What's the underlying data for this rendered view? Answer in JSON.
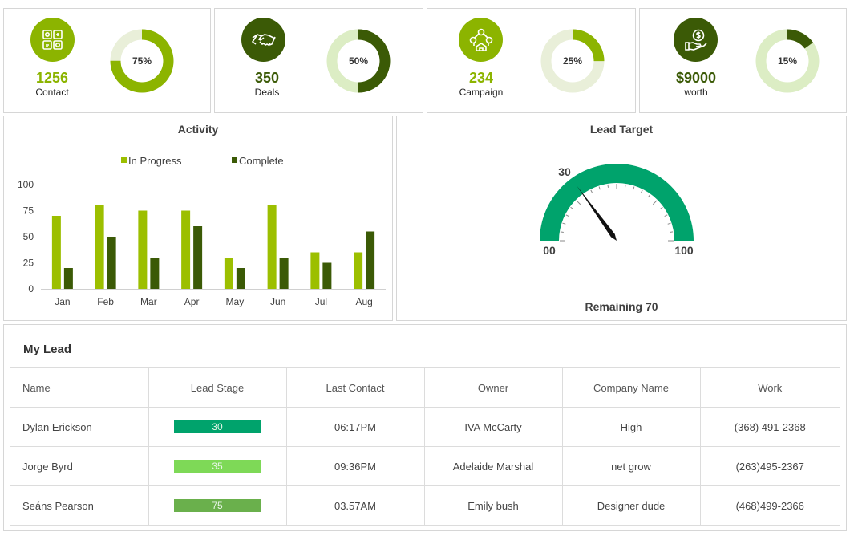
{
  "kpis": [
    {
      "value": "1256",
      "label": "Contact",
      "percent": 75,
      "percent_label": "75%",
      "color": "#8cb400",
      "track": "#e9efd9",
      "icon_bg": "#8cb400",
      "icon": "contact-apps-icon"
    },
    {
      "value": "350",
      "label": "Deals",
      "percent": 50,
      "percent_label": "50%",
      "color": "#3b5a06",
      "track": "#dcedc4",
      "icon_bg": "#3b5a06",
      "icon": "handshake-icon"
    },
    {
      "value": "234",
      "label": "Campaign",
      "percent": 25,
      "percent_label": "25%",
      "color": "#8cb400",
      "track": "#e9efd9",
      "icon_bg": "#8cb400",
      "icon": "campaign-network-icon"
    },
    {
      "value": "$9000",
      "label": "worth",
      "percent": 15,
      "percent_label": "15%",
      "color": "#3b5a06",
      "track": "#dcedc4",
      "icon_bg": "#3b5a06",
      "icon": "money-hand-icon"
    }
  ],
  "activity": {
    "title": "Activity",
    "chart_data": {
      "type": "bar",
      "categories": [
        "Jan",
        "Feb",
        "Mar",
        "Apr",
        "May",
        "Jun",
        "Jul",
        "Aug"
      ],
      "series": [
        {
          "name": "In Progress",
          "values": [
            70,
            80,
            75,
            75,
            30,
            80,
            35,
            35
          ],
          "color": "#9cbf00"
        },
        {
          "name": "Complete",
          "values": [
            20,
            50,
            30,
            60,
            20,
            30,
            25,
            55
          ],
          "color": "#3b5a06"
        }
      ],
      "yticks": [
        "0",
        "25",
        "50",
        "75",
        "100"
      ],
      "ylim": [
        0,
        100
      ],
      "legend": "top",
      "grid": false
    }
  },
  "lead_target": {
    "title": "Lead Target",
    "value": 30,
    "value_label": "30",
    "min_label": "00",
    "max_label": "100",
    "min": 0,
    "max": 100,
    "remaining": "Remaining 70",
    "color": "#00a36c"
  },
  "my_lead": {
    "title": "My Lead",
    "headers": [
      "Name",
      "Lead Stage",
      "Last Contact",
      "Owner",
      "Company Name",
      "Work"
    ],
    "rows": [
      {
        "name": "Dylan Erickson",
        "stage": "30",
        "stage_color": "#00a36c",
        "last_contact": "06:17PM",
        "owner": "IVA  McCarty",
        "company": "High",
        "work": "(368) 491-2368"
      },
      {
        "name": "Jorge Byrd",
        "stage": "35",
        "stage_color": "#7ed957",
        "last_contact": "09:36PM",
        "owner": "Adelaide Marshal",
        "company": "net grow",
        "work": "(263)495-2367"
      },
      {
        "name": "Seáns Pearson",
        "stage": "75",
        "stage_color": "#6ab04c",
        "last_contact": "03.57AM",
        "owner": "Emily bush",
        "company": "Designer dude",
        "work": "(468)499-2366"
      }
    ]
  }
}
